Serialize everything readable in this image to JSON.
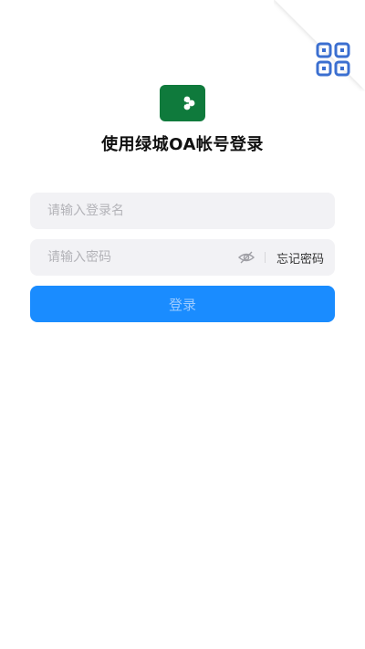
{
  "header": {
    "title": "使用绿城OA帐号登录"
  },
  "icons": {
    "qr": "qr-code-icon",
    "logo": "clover-moon-logo",
    "eye": "eye-off-icon"
  },
  "form": {
    "username_placeholder": "请输入登录名",
    "username_value": "",
    "password_placeholder": "请输入密码",
    "password_value": "",
    "forgot_label": "忘记密码",
    "login_label": "登录"
  },
  "colors": {
    "brand_green": "#0f7a3c",
    "primary_blue": "#1a8cff",
    "field_bg": "#f2f2f5",
    "qr_blue": "#3b6fd0"
  }
}
